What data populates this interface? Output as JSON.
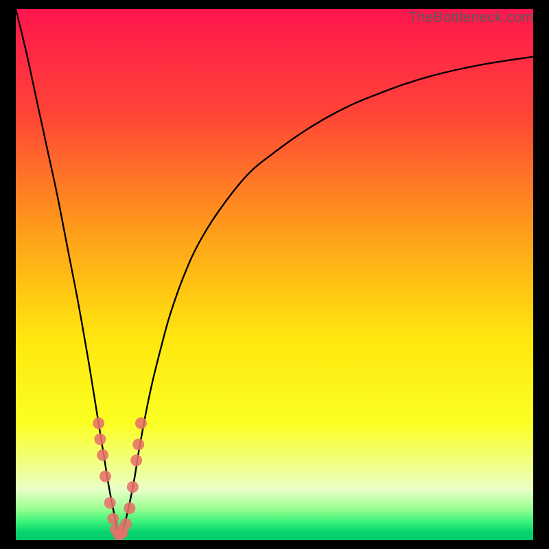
{
  "watermark": "TheBottleneck.com",
  "colors": {
    "frame": "#000000",
    "curve": "#000000",
    "dots": "#e77169",
    "gradient_stops": [
      {
        "offset": 0.0,
        "color": "#ff154e"
      },
      {
        "offset": 0.2,
        "color": "#ff4536"
      },
      {
        "offset": 0.42,
        "color": "#ff9e1a"
      },
      {
        "offset": 0.62,
        "color": "#ffe70f"
      },
      {
        "offset": 0.78,
        "color": "#fbff22"
      },
      {
        "offset": 0.86,
        "color": "#f1ff8a"
      },
      {
        "offset": 0.905,
        "color": "#e9ffc8"
      },
      {
        "offset": 0.94,
        "color": "#9dff93"
      },
      {
        "offset": 0.965,
        "color": "#3cf47a"
      },
      {
        "offset": 0.985,
        "color": "#06d46e"
      },
      {
        "offset": 1.0,
        "color": "#05c969"
      }
    ]
  },
  "chart_data": {
    "type": "line",
    "title": "",
    "xlabel": "",
    "ylabel": "",
    "xlim": [
      0,
      100
    ],
    "ylim": [
      0,
      100
    ],
    "note": "Axes have no visible tick labels; x is relative position (0–100), y is bottleneck % (0 good, 100 bad). Curve forms a V with minimum near x≈20.",
    "series": [
      {
        "name": "bottleneck-curve",
        "x": [
          0,
          2,
          4,
          6,
          8,
          10,
          12,
          14,
          16,
          17,
          18,
          19,
          20,
          21,
          22,
          23,
          24,
          26,
          28,
          30,
          33,
          36,
          40,
          45,
          50,
          55,
          60,
          65,
          70,
          75,
          80,
          85,
          90,
          95,
          100
        ],
        "y": [
          100,
          92,
          83,
          74,
          65,
          55,
          45,
          34,
          22,
          16,
          10,
          5,
          1,
          3,
          7,
          12,
          18,
          28,
          36,
          43,
          51,
          57,
          63,
          69,
          73,
          76.5,
          79.5,
          82,
          84,
          85.8,
          87.3,
          88.5,
          89.5,
          90.3,
          91
        ]
      }
    ],
    "dots": {
      "name": "bottleneck-dots",
      "x": [
        16.0,
        16.3,
        16.8,
        17.3,
        18.2,
        18.8,
        19.3,
        19.9,
        20.6,
        21.3,
        22.0,
        22.6,
        23.3,
        23.7,
        24.2
      ],
      "y": [
        22,
        19,
        16,
        12,
        7,
        4,
        2,
        1,
        1.4,
        3,
        6,
        10,
        15,
        18,
        22
      ]
    }
  }
}
